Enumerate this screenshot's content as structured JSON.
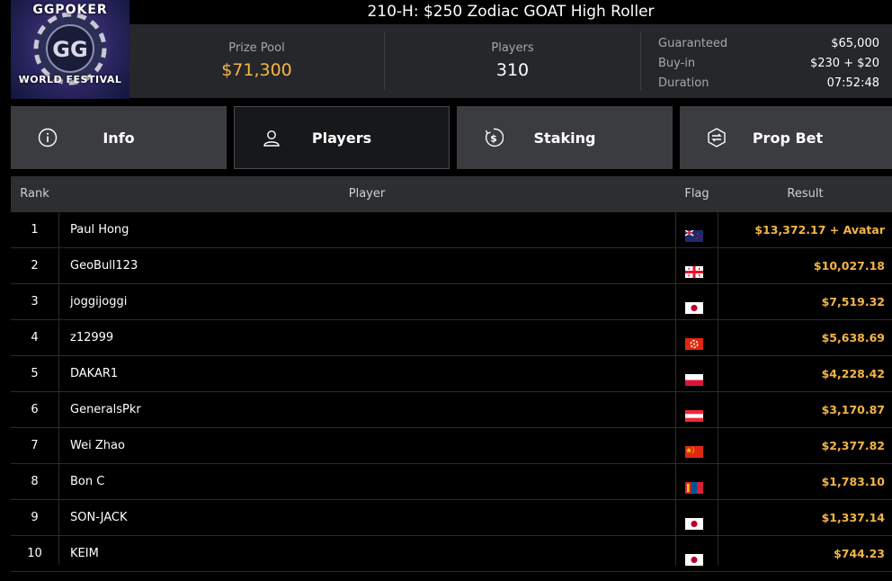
{
  "logo": {
    "line1": "GGPOKER",
    "line2": "WORLD FESTIVAL"
  },
  "title": "210-H: $250 Zodiac GOAT High Roller",
  "stats": {
    "prize_pool_label": "Prize Pool",
    "prize_pool_value": "$71,300",
    "players_label": "Players",
    "players_value": "310"
  },
  "details": [
    {
      "label": "Guaranteed",
      "value": "$65,000"
    },
    {
      "label": "Buy-in",
      "value": "$230 + $20"
    },
    {
      "label": "Duration",
      "value": "07:52:48"
    }
  ],
  "tabs": [
    {
      "label": "Info",
      "icon": "info-icon",
      "active": false
    },
    {
      "label": "Players",
      "icon": "user-icon",
      "active": true
    },
    {
      "label": "Staking",
      "icon": "dollar-coin-icon",
      "active": false
    },
    {
      "label": "Prop Bet",
      "icon": "prop-bet-icon",
      "active": false
    }
  ],
  "table": {
    "headers": {
      "rank": "Rank",
      "player": "Player",
      "flag": "Flag",
      "result": "Result"
    },
    "rows": [
      {
        "rank": "1",
        "player": "Paul Hong",
        "flag": "new-zealand-flag-icon",
        "result": "$13,372.17 + Avatar"
      },
      {
        "rank": "2",
        "player": "GeoBull123",
        "flag": "georgia-flag-icon",
        "result": "$10,027.18"
      },
      {
        "rank": "3",
        "player": "joggijoggi",
        "flag": "japan-flag-icon",
        "result": "$7,519.32"
      },
      {
        "rank": "4",
        "player": "z12999",
        "flag": "hong-kong-flag-icon",
        "result": "$5,638.69"
      },
      {
        "rank": "5",
        "player": "DAKAR1",
        "flag": "poland-flag-icon",
        "result": "$4,228.42"
      },
      {
        "rank": "6",
        "player": "GeneralsPkr",
        "flag": "austria-flag-icon",
        "result": "$3,170.87"
      },
      {
        "rank": "7",
        "player": "Wei Zhao",
        "flag": "china-flag-icon",
        "result": "$2,377.82"
      },
      {
        "rank": "8",
        "player": "Bon C",
        "flag": "mongolia-flag-icon",
        "result": "$1,783.10"
      },
      {
        "rank": "9",
        "player": "SON-JACK",
        "flag": "japan-flag-icon",
        "result": "$1,337.14"
      },
      {
        "rank": "10",
        "player": "KEIM",
        "flag": "japan-flag-icon",
        "result": "$744.23"
      }
    ]
  },
  "colors": {
    "accent": "#f6b546",
    "panel": "#26272b",
    "tab": "#3b3c40",
    "header": "#2d2e32"
  }
}
